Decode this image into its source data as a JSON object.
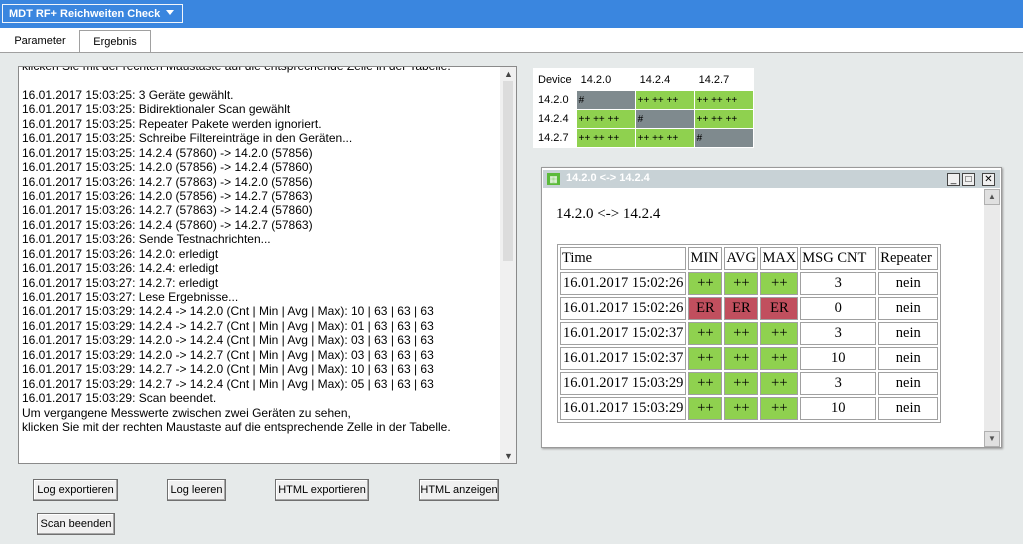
{
  "app": {
    "title": "MDT RF+ Reichweiten Check"
  },
  "tabs": [
    {
      "label": "Parameter"
    },
    {
      "label": "Ergebnis"
    }
  ],
  "log": {
    "lines": [
      "klicken Sie mit der rechten Maustaste auf die entsprechende Zelle in der Tabelle.",
      "",
      "16.01.2017 15:03:25: 3 Geräte gewählt.",
      "16.01.2017 15:03:25: Bidirektionaler Scan gewählt",
      "16.01.2017 15:03:25: Repeater Pakete werden ignoriert.",
      "16.01.2017 15:03:25: Schreibe Filtereinträge in den Geräten...",
      "16.01.2017 15:03:25: 14.2.4 (57860) -> 14.2.0 (57856)",
      "16.01.2017 15:03:25: 14.2.0 (57856) -> 14.2.4 (57860)",
      "16.01.2017 15:03:26: 14.2.7 (57863) -> 14.2.0 (57856)",
      "16.01.2017 15:03:26: 14.2.0 (57856) -> 14.2.7 (57863)",
      "16.01.2017 15:03:26: 14.2.7 (57863) -> 14.2.4 (57860)",
      "16.01.2017 15:03:26: 14.2.4 (57860) -> 14.2.7 (57863)",
      "16.01.2017 15:03:26: Sende Testnachrichten...",
      "16.01.2017 15:03:26: 14.2.0: erledigt",
      "16.01.2017 15:03:26: 14.2.4: erledigt",
      "16.01.2017 15:03:27: 14.2.7: erledigt",
      "16.01.2017 15:03:27: Lese Ergebnisse...",
      "16.01.2017 15:03:29: 14.2.4 -> 14.2.0 (Cnt | Min | Avg | Max): 10 | 63 | 63 | 63",
      "16.01.2017 15:03:29: 14.2.4 -> 14.2.7 (Cnt | Min | Avg | Max): 01 | 63 | 63 | 63",
      "16.01.2017 15:03:29: 14.2.0 -> 14.2.4 (Cnt | Min | Avg | Max): 03 | 63 | 63 | 63",
      "16.01.2017 15:03:29: 14.2.0 -> 14.2.7 (Cnt | Min | Avg | Max): 03 | 63 | 63 | 63",
      "16.01.2017 15:03:29: 14.2.7 -> 14.2.0 (Cnt | Min | Avg | Max): 10 | 63 | 63 | 63",
      "16.01.2017 15:03:29: 14.2.7 -> 14.2.4 (Cnt | Min | Avg | Max): 05 | 63 | 63 | 63",
      "16.01.2017 15:03:29: Scan beendet.",
      "Um vergangene Messwerte zwischen zwei Geräten zu sehen,",
      "klicken Sie mit der rechten Maustaste auf die entsprechende Zelle in der Tabelle."
    ]
  },
  "buttons": {
    "export_log": "Log exportieren",
    "clear_log": "Log leeren",
    "export_html": "HTML exportieren",
    "show_html": "HTML anzeigen",
    "stop_scan": "Scan beenden"
  },
  "matrix": {
    "header": [
      "Device",
      "14.2.0",
      "14.2.4",
      "14.2.7"
    ],
    "rows": [
      {
        "device": "14.2.0",
        "cells": [
          {
            "text": "#",
            "status": "self"
          },
          {
            "text": "++ ++ ++",
            "status": "ok"
          },
          {
            "text": "++ ++ ++",
            "status": "ok"
          }
        ]
      },
      {
        "device": "14.2.4",
        "cells": [
          {
            "text": "++ ++ ++",
            "status": "ok"
          },
          {
            "text": "#",
            "status": "self"
          },
          {
            "text": "++ ++ ++",
            "status": "ok"
          }
        ]
      },
      {
        "device": "14.2.7",
        "cells": [
          {
            "text": "++ ++ ++",
            "status": "ok"
          },
          {
            "text": "++ ++ ++",
            "status": "ok"
          },
          {
            "text": "#",
            "status": "self"
          }
        ]
      }
    ],
    "colors": {
      "ok": "#8fd14f",
      "self": "#7f8a8e"
    }
  },
  "popup": {
    "title": "14.2.0 <-> 14.2.4",
    "heading": "14.2.0 <-> 14.2.4",
    "icon": "table-icon",
    "columns": [
      "Time",
      "MIN",
      "AVG",
      "MAX",
      "MSG CNT",
      "Repeater"
    ],
    "rows": [
      {
        "time": "16.01.2017 15:02:26",
        "min": "++",
        "avg": "++",
        "max": "++",
        "cnt": "3",
        "rep": "nein",
        "status": "ok"
      },
      {
        "time": "16.01.2017 15:02:26",
        "min": "ER",
        "avg": "ER",
        "max": "ER",
        "cnt": "0",
        "rep": "nein",
        "status": "error"
      },
      {
        "time": "16.01.2017 15:02:37",
        "min": "++",
        "avg": "++",
        "max": "++",
        "cnt": "3",
        "rep": "nein",
        "status": "ok"
      },
      {
        "time": "16.01.2017 15:02:37",
        "min": "++",
        "avg": "++",
        "max": "++",
        "cnt": "10",
        "rep": "nein",
        "status": "ok"
      },
      {
        "time": "16.01.2017 15:03:29",
        "min": "++",
        "avg": "++",
        "max": "++",
        "cnt": "3",
        "rep": "nein",
        "status": "ok"
      },
      {
        "time": "16.01.2017 15:03:29",
        "min": "++",
        "avg": "++",
        "max": "++",
        "cnt": "10",
        "rep": "nein",
        "status": "ok"
      }
    ],
    "colors": {
      "ok": "#8fd14f",
      "error": "#c14f5e"
    }
  }
}
